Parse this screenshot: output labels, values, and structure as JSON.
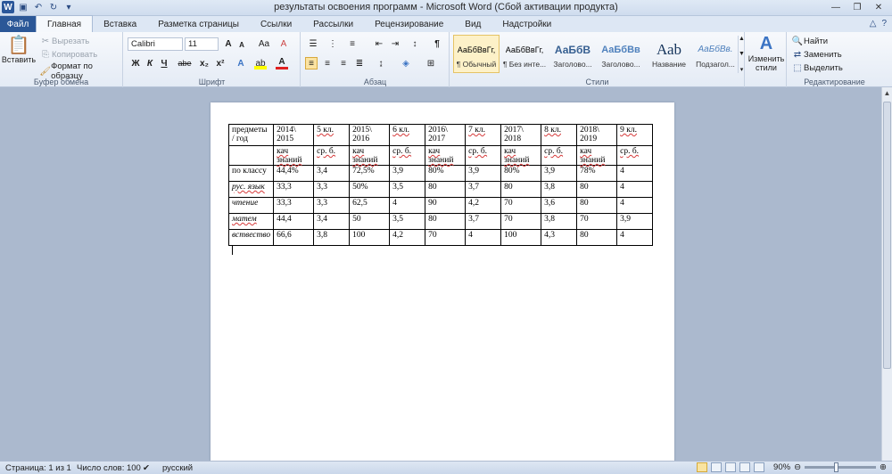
{
  "window": {
    "title": "результаты освоения программ - Microsoft Word (Сбой активации продукта)",
    "app_icon_letter": "W"
  },
  "tabs": [
    "Файл",
    "Главная",
    "Вставка",
    "Разметка страницы",
    "Ссылки",
    "Рассылки",
    "Рецензирование",
    "Вид",
    "Надстройки"
  ],
  "ribbon": {
    "clipboard": {
      "label": "Буфер обмена",
      "paste": "Вставить",
      "cut": "Вырезать",
      "copy": "Копировать",
      "format_painter": "Формат по образцу"
    },
    "font": {
      "label": "Шрифт",
      "font_name": "Calibri",
      "font_size": "11",
      "bold": "Ж",
      "italic": "К",
      "underline": "Ч",
      "strike": "abe",
      "subscript": "x₂",
      "superscript": "x²",
      "grow": "A",
      "shrink": "A",
      "case": "Aa",
      "clear": "A"
    },
    "paragraph": {
      "label": "Абзац",
      "pilcrow": "¶"
    },
    "styles": {
      "label": "Стили",
      "items": [
        {
          "preview": "АаБбВвГг,",
          "name": "¶ Обычный"
        },
        {
          "preview": "АаБбВвГг,",
          "name": "¶ Без инте..."
        },
        {
          "preview": "АаБбВ",
          "name": "Заголово..."
        },
        {
          "preview": "АаБбВв",
          "name": "Заголово..."
        },
        {
          "preview": "Ааb",
          "name": "Название"
        },
        {
          "preview": "АаБбВв.",
          "name": "Подзагол..."
        }
      ],
      "change_styles": "Изменить стили"
    },
    "editing": {
      "label": "Редактирование",
      "find": "Найти",
      "replace": "Заменить",
      "select": "Выделить"
    }
  },
  "document": {
    "table": {
      "header": [
        "предметы / год",
        "2014\\ 2015",
        "5 кл.",
        "2015\\ 2016",
        "6 кл.",
        "2016\\ 2017",
        "7 кл.",
        "2017\\ 2018",
        "8 кл.",
        "2018\\ 2019",
        "9 кл."
      ],
      "subheader": [
        "",
        "кач знаний",
        "ср. б.",
        "кач знаний",
        "ср. б.",
        "кач знаний",
        "ср. б.",
        "кач знаний",
        "ср. б.",
        "кач знаний",
        "ср. б."
      ],
      "rows": [
        [
          "по классу",
          "44,4%",
          "3,4",
          "72,5%",
          "3,9",
          "80%",
          "3,9",
          "80%",
          "3,9",
          "78%",
          "4"
        ],
        [
          "рус. язык",
          "33,3",
          "3,3",
          "50%",
          "3,5",
          "80",
          "3,7",
          "80",
          "3,8",
          "80",
          "4"
        ],
        [
          "чтение",
          "33,3",
          "3,3",
          "62,5",
          "4",
          "90",
          "4,2",
          "70",
          "3,6",
          "80",
          "4"
        ],
        [
          "матем",
          "44,4",
          "3,4",
          "50",
          "3,5",
          "80",
          "3,7",
          "70",
          "3,8",
          "70",
          "3,9"
        ],
        [
          "вствество",
          "66,6",
          "3,8",
          "100",
          "4,2",
          "70",
          "4",
          "100",
          "4,3",
          "80",
          "4"
        ]
      ]
    }
  },
  "status": {
    "page": "Страница: 1 из 1",
    "words": "Число слов: 100",
    "language": "русский",
    "zoom": "90%",
    "zoom_percent": 90
  }
}
